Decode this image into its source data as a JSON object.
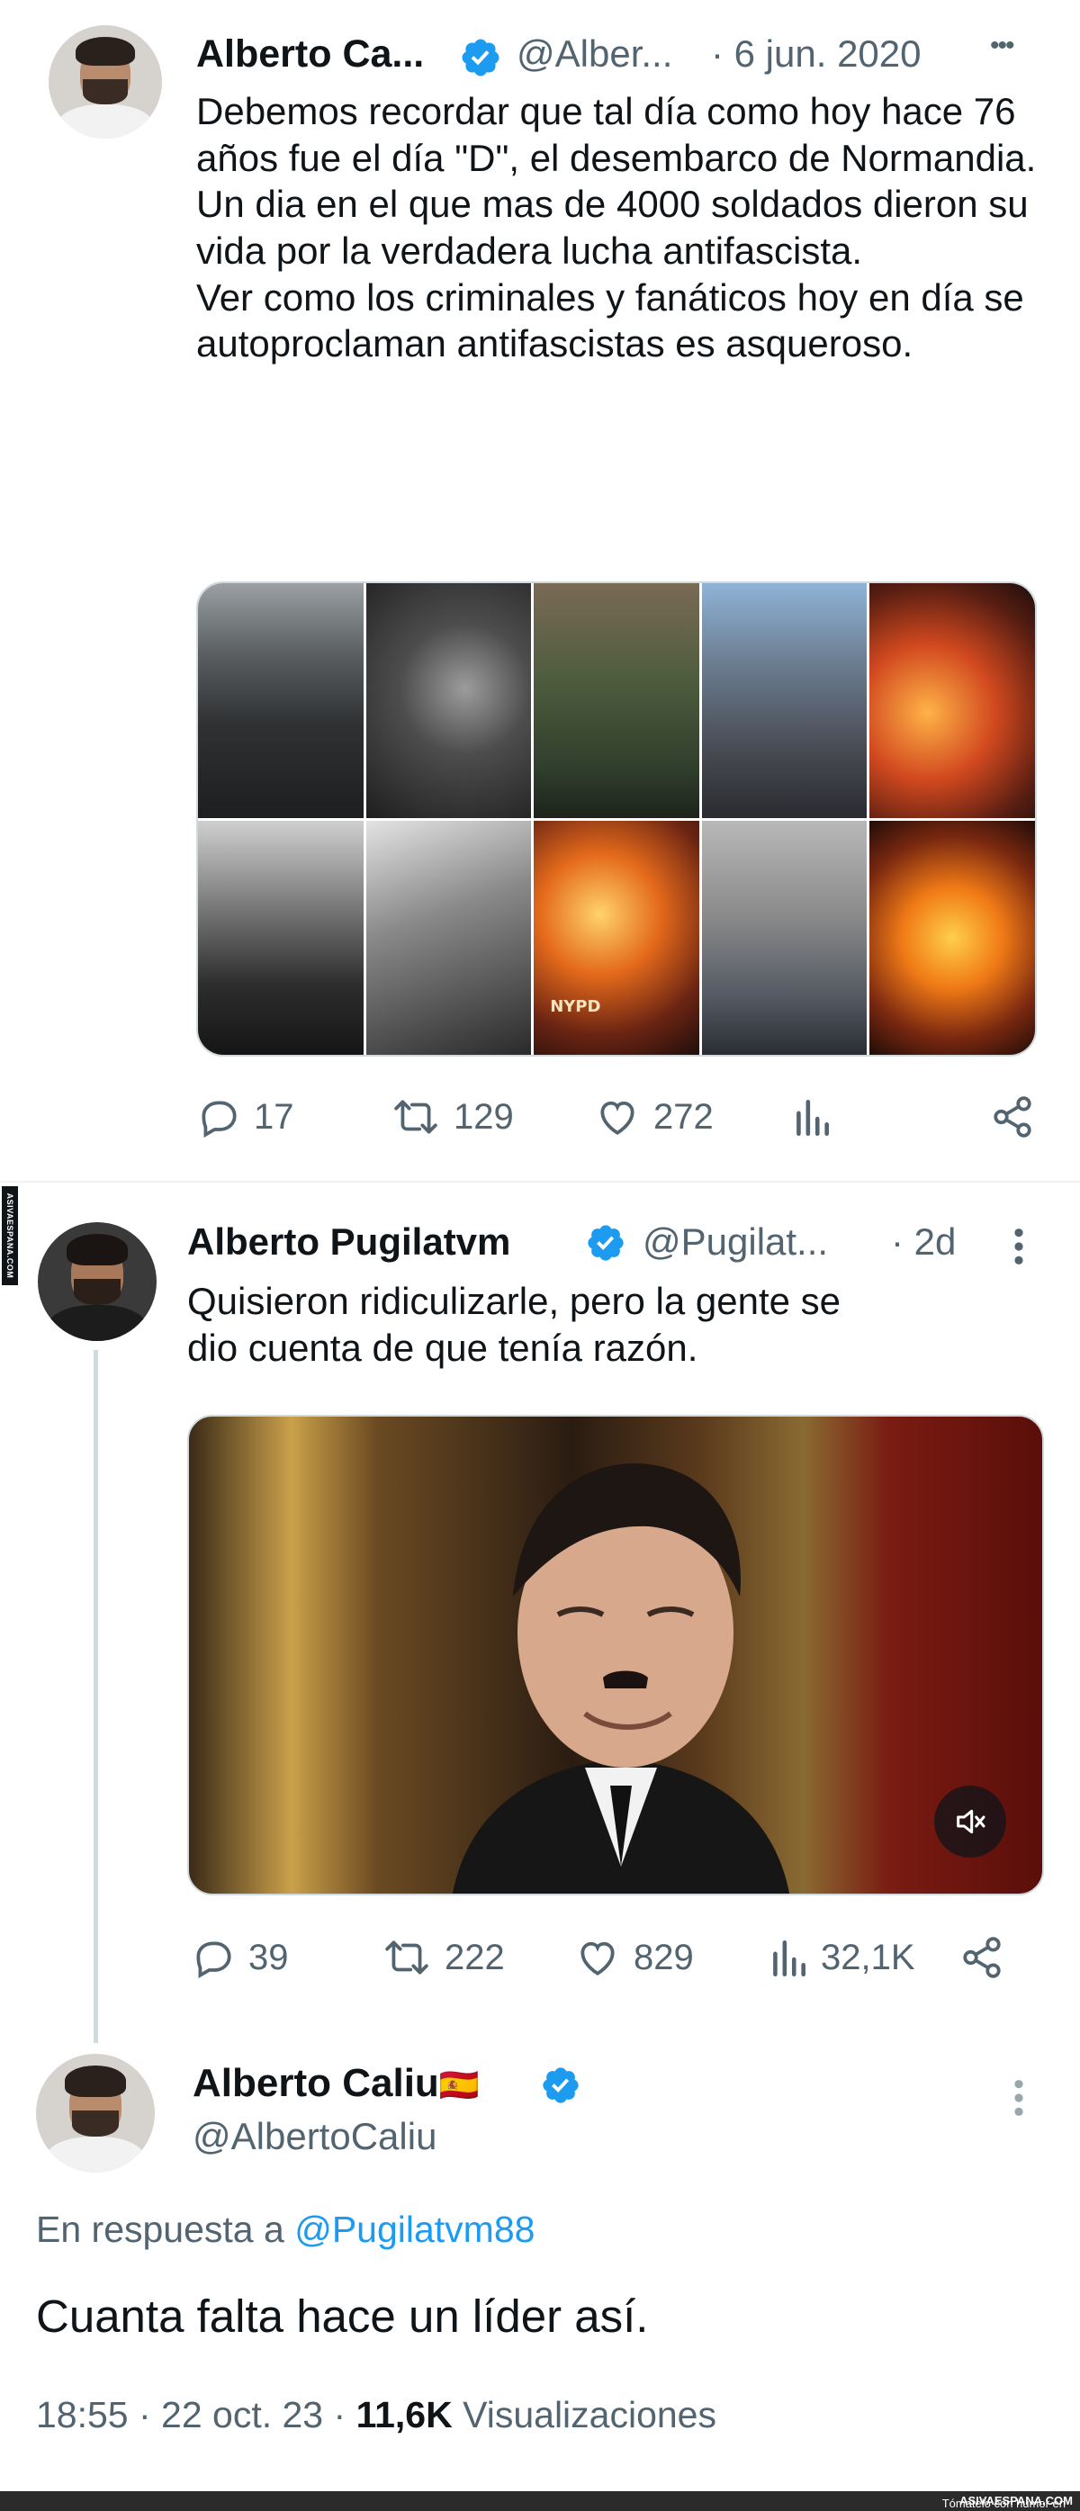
{
  "watermark_side": "ASIVAESPANA.COM",
  "footer": {
    "text_prefix": "Tómatelo con humor en",
    "text_site": "ASIVAESPANA.COM"
  },
  "tweet1": {
    "name": "Alberto Ca...",
    "handle": "@Alber...",
    "date": "· 6 jun. 2020",
    "more": "•••",
    "paragraphs": [
      "Debemos recordar que tal día como hoy hace 76 años fue el día \"D\", el desembarco de Normandia. Un dia en el que mas de 4000 soldados dieron su vida por la verdadera lucha antifascista.",
      "Ver como los criminales y fanáticos hoy en día se autoproclaman antifascistas es asqueroso."
    ],
    "image_labels": {
      "nypd": "NYPD"
    },
    "actions": {
      "replies": "17",
      "retweets": "129",
      "likes": "272"
    },
    "icons": [
      "reply-icon",
      "retweet-icon",
      "like-icon",
      "views-icon",
      "share-icon"
    ]
  },
  "tweet2": {
    "name": "Alberto Pugilatvm",
    "handle": "@Pugilat...",
    "date": "· 2d",
    "text_line1": "Quisieron ridiculizarle, pero la gente se",
    "text_line2": "dio cuenta de que tenía razón.",
    "actions": {
      "replies": "39",
      "retweets": "222",
      "likes": "829",
      "views": "32,1K"
    }
  },
  "tweet3": {
    "name": "Alberto Caliu",
    "flag": "🇪🇸",
    "handle": "@AlbertoCaliu",
    "reply_prefix": "En respuesta a",
    "reply_handle": "@Pugilatvm88",
    "text": "Cuanta falta hace un líder así.",
    "time": "18:55 · 22 oct. 23 ·",
    "views_count": "11,6K",
    "views_label": "Visualizaciones"
  },
  "colors": {
    "text": "#0f1419",
    "secondary": "#536471",
    "link": "#1d9bf0",
    "verified": "#1d9bf0",
    "divider": "#eff3f4"
  }
}
